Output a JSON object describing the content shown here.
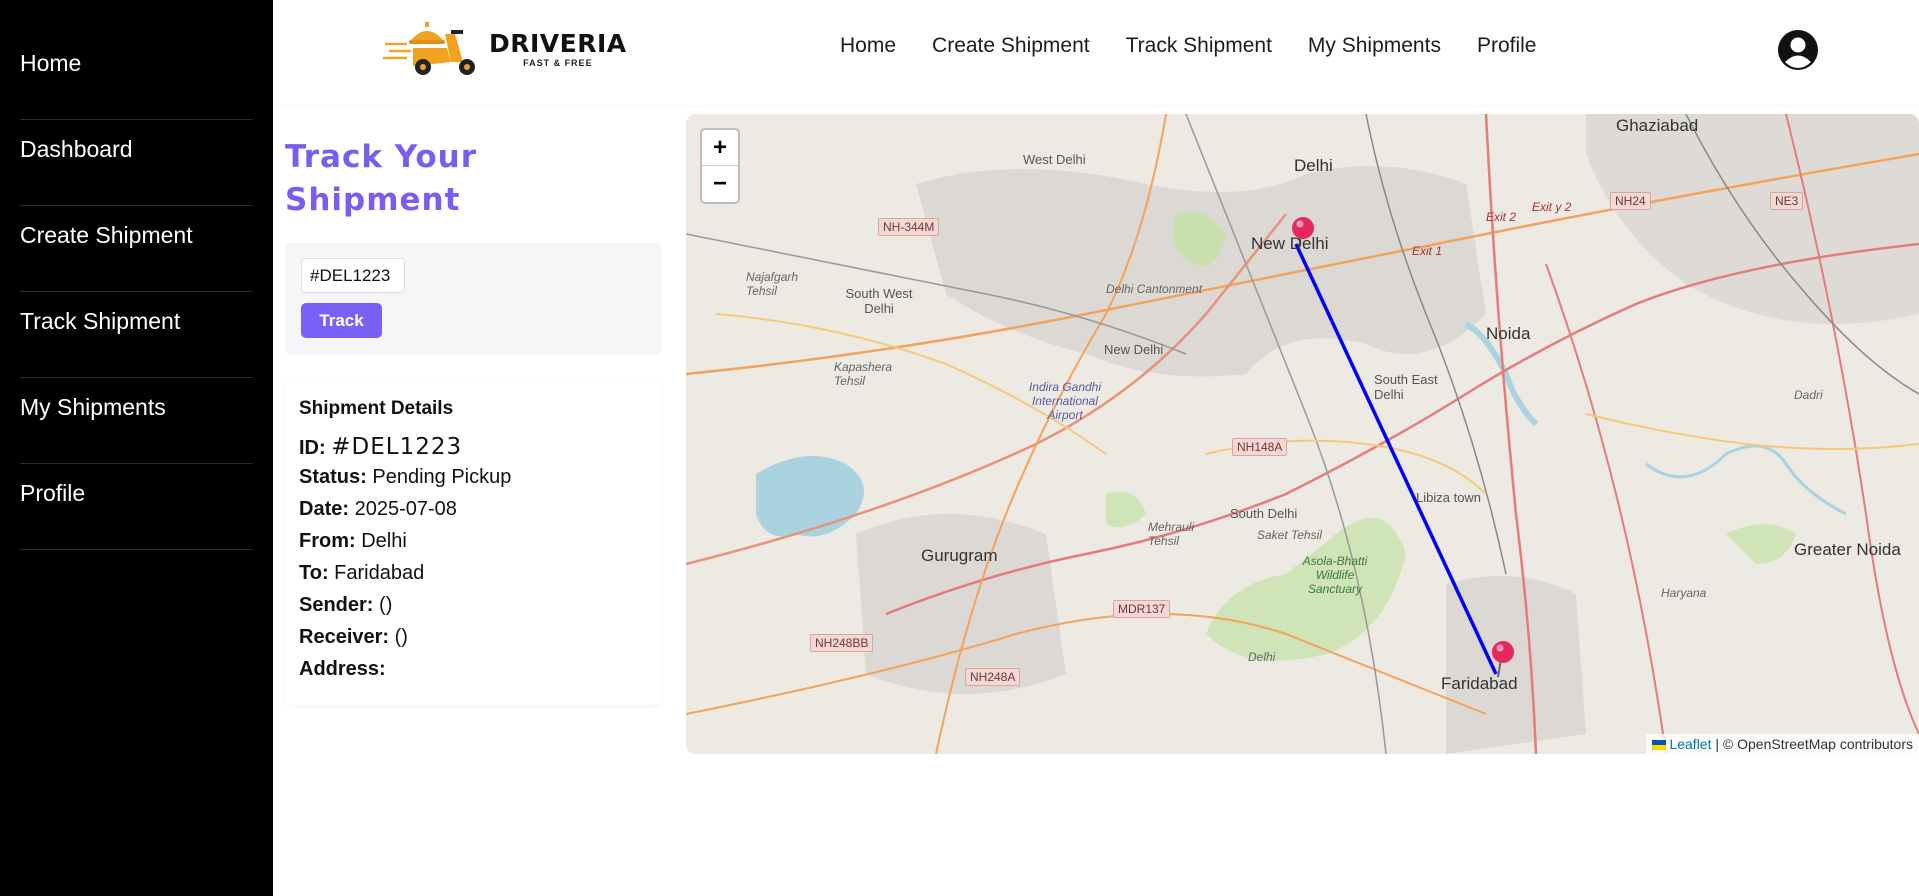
{
  "sidebar": {
    "items": [
      {
        "label": "Home"
      },
      {
        "label": "Dashboard"
      },
      {
        "label": "Create Shipment"
      },
      {
        "label": "Track Shipment"
      },
      {
        "label": "My Shipments"
      },
      {
        "label": "Profile"
      }
    ]
  },
  "header": {
    "logo_name": "DRIVERIA",
    "logo_tagline": "FAST & FREE",
    "nav": [
      {
        "label": "Home"
      },
      {
        "label": "Create Shipment"
      },
      {
        "label": "Track Shipment"
      },
      {
        "label": "My Shipments"
      },
      {
        "label": "Profile"
      }
    ],
    "avatar_icon": "user-circle-icon"
  },
  "tracking": {
    "title": "Track Your Shipment",
    "input_value": "#DEL1223",
    "button_label": "Track"
  },
  "details": {
    "title": "Shipment Details",
    "id_label": "ID:",
    "id_value": "#DEL1223",
    "status_label": "Status:",
    "status_value": "Pending Pickup",
    "date_label": "Date:",
    "date_value": "2025-07-08",
    "from_label": "From:",
    "from_value": "Delhi",
    "to_label": "To:",
    "to_value": "Faridabad",
    "sender_label": "Sender:",
    "sender_value": "()",
    "receiver_label": "Receiver:",
    "receiver_value": "()",
    "address_label": "Address:",
    "address_value": ""
  },
  "map": {
    "zoom_in": "+",
    "zoom_out": "−",
    "attribution_link": "Leaflet",
    "attribution_text": " | © OpenStreetMap contributors",
    "route_color": "#0000ff",
    "marker_color": "#e8285c",
    "labels": {
      "delhi": "Delhi",
      "new_delhi": "New Delhi",
      "new_delhi_2": "New Delhi",
      "ghaziabad": "Ghaziabad",
      "noida": "Noida",
      "gurugram": "Gurugram",
      "faridabad": "Faridabad",
      "greater_noida": "Greater Noida",
      "south_delhi": "South Delhi",
      "south_east_delhi": "South East Delhi",
      "south_west_delhi": "South West Delhi",
      "west_delhi": "West Delhi",
      "libiza_town": "Libiza town",
      "delhi_cantonment": "Delhi Cantonment",
      "najafgarh": "Najafgarh Tehsil",
      "kapashera": "Kapashera Tehsil",
      "mehrauli": "Mehrauli Tehsil",
      "saket": "Saket Tehsil",
      "airport": "Indira Gandhi International Airport",
      "sanctuary": "Asola-Bhatti Wildlife Sanctuary",
      "dadri": "Dadri",
      "haryana": "Haryana",
      "delhi_small": "Delhi"
    },
    "shields": {
      "nh344m": "NH-344M",
      "nh148a": "NH148A",
      "nh24": "NH24",
      "ne3": "NE3",
      "mdr137": "MDR137",
      "nh248bb": "NH248BB",
      "nh248a": "NH248A",
      "exit2": "Exit 2",
      "exity2": "Exit y 2",
      "exit1": "Exit 1"
    }
  }
}
